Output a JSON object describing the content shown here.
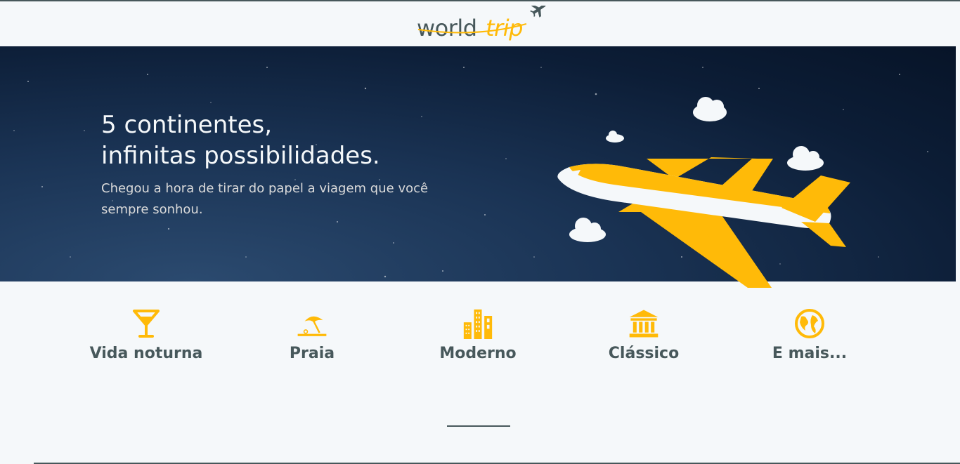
{
  "header": {
    "logo_word_1": "world",
    "logo_word_2": "trip",
    "logo_icon": "airplane-icon"
  },
  "banner": {
    "title_line_1": "5 continentes,",
    "title_line_2": "infinitas possibilidades.",
    "subtitle": "Chegou a hora de tirar do papel a viagem que você sempre sonhou.",
    "illustration": "airplane-with-clouds"
  },
  "travel_types": [
    {
      "label": "Vida noturna",
      "icon": "cocktail-icon"
    },
    {
      "label": "Praia",
      "icon": "beach-umbrella-icon"
    },
    {
      "label": "Moderno",
      "icon": "buildings-icon"
    },
    {
      "label": "Clássico",
      "icon": "museum-icon"
    },
    {
      "label": "E mais...",
      "icon": "globe-icon"
    }
  ],
  "colors": {
    "highlight": "#FFBA08",
    "dark_text": "#47585B",
    "light": "#F5F8FA",
    "banner_bg": "#0C1D36"
  }
}
